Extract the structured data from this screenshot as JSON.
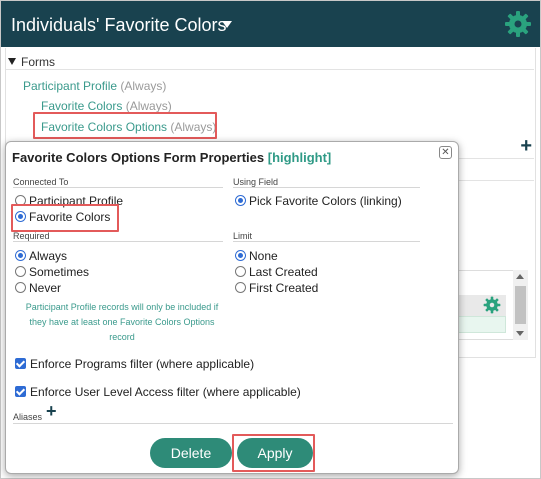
{
  "header": {
    "title": "Individuals' Favorite Colors"
  },
  "colors": {
    "header_bg": "#19424f",
    "accent_green": "#2e8b78",
    "link_teal": "#3a9a8c",
    "highlight_red": "#e35a5a",
    "radio_blue": "#2e6bd4"
  },
  "forms": {
    "section_label": "Forms",
    "items": [
      {
        "name": "Participant Profile",
        "qualifier": "(Always)"
      },
      {
        "name": "Favorite Colors",
        "qualifier": "(Always)"
      },
      {
        "name": "Favorite Colors Options",
        "qualifier": "(Always)"
      }
    ]
  },
  "dialog": {
    "title": "Favorite Colors Options Form Properties",
    "title_tag": "[highlight]",
    "close_glyph": "✕",
    "connected_to": {
      "label": "Connected To",
      "options": [
        "Participant Profile",
        "Favorite Colors"
      ],
      "selected": "Favorite Colors"
    },
    "using_field": {
      "label": "Using Field",
      "options": [
        "Pick Favorite Colors (linking)"
      ],
      "selected": "Pick Favorite Colors (linking)"
    },
    "required": {
      "label": "Required",
      "options": [
        "Always",
        "Sometimes",
        "Never"
      ],
      "selected": "Always"
    },
    "limit": {
      "label": "Limit",
      "options": [
        "None",
        "Last Created",
        "First Created"
      ],
      "selected": "None"
    },
    "note": "Participant Profile records will only be included if they have at least one Favorite Colors Options record",
    "checkboxes": [
      {
        "label": "Enforce Programs filter (where applicable)",
        "checked": true
      },
      {
        "label": "Enforce User Level Access filter (where applicable)",
        "checked": true
      }
    ],
    "aliases_label": "Aliases",
    "delete_label": "Delete",
    "apply_label": "Apply"
  },
  "icons": {
    "header_settings": "gear-icon",
    "list_settings": "gear-icon",
    "add_form": "plus-icon",
    "add_alias": "plus-icon",
    "close": "close-icon"
  }
}
